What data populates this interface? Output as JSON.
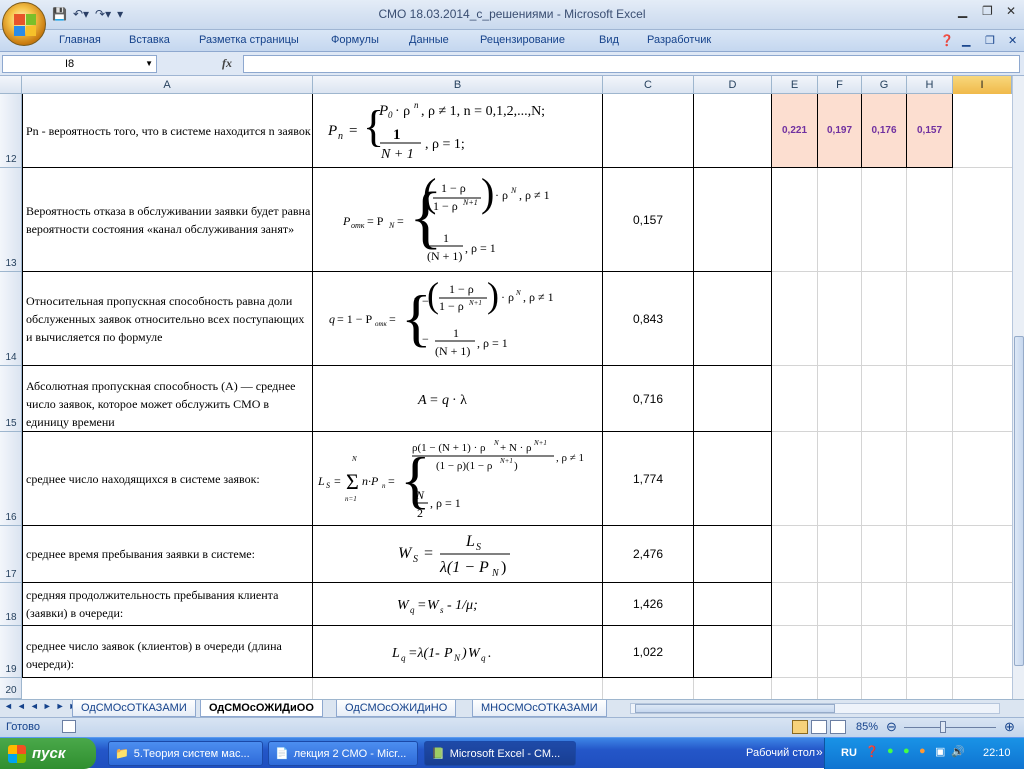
{
  "title": "СМО 18.03.2014_с_решениями - Microsoft Excel",
  "ribbon_tabs": [
    "Главная",
    "Вставка",
    "Разметка страницы",
    "Формулы",
    "Данные",
    "Рецензирование",
    "Вид",
    "Разработчик"
  ],
  "name_box": "I8",
  "fx_label": "fx",
  "columns": [
    "A",
    "B",
    "C",
    "D",
    "E",
    "F",
    "G",
    "H",
    "I"
  ],
  "rows": {
    "r12": {
      "num": "12",
      "text": "Pn  - вероятность того, что в системе находится n заявок",
      "values": [
        "0,221",
        "0,197",
        "0,176",
        "0,157"
      ]
    },
    "r13": {
      "num": "13",
      "text": "Вероятность отказа в обслуживании заявки будет равна вероятности состояния «канал обслуживания занят»",
      "c": "0,157"
    },
    "r14": {
      "num": "14",
      "text": "Относительная пропускная способность равна доли обслуженных заявок относительно всех поступающих и вычисляется по формуле",
      "c": "0,843"
    },
    "r15": {
      "num": "15",
      "text": "Абсолютная пропускная способность (А) — среднее число заявок, которое может обслужить СМО в единицу времени",
      "c": "0,716"
    },
    "r16": {
      "num": "16",
      "text": "среднее число находящихся в системе заявок:",
      "c": "1,774"
    },
    "r17": {
      "num": "17",
      "text": "среднее время пребывания заявки в системе:",
      "c": "2,476"
    },
    "r18": {
      "num": "18",
      "text": "средняя продолжительность пребывания клиента (заявки) в очереди:",
      "c": "1,426"
    },
    "r19": {
      "num": "19",
      "text": "среднее число заявок (клиентов) в очереди (длина очереди):",
      "c": "1,022"
    },
    "r20": {
      "num": "20"
    }
  },
  "sheet_tabs": [
    "ОдСМОсОТКАЗАМИ",
    "ОдСМОсОЖИДиОО",
    "ОдСМОсОЖИДиНО",
    "МНОСМОсОТКАЗАМИ"
  ],
  "active_sheet": 1,
  "status": {
    "ready": "Готово",
    "zoom": "85%"
  },
  "taskbar": {
    "start": "пуск",
    "tasks": [
      "5.Теория систем мас...",
      "лекция 2 СМО - Micr...",
      "Microsoft Excel - СМ..."
    ],
    "desktop": "Рабочий стол",
    "lang": "RU",
    "clock": "22:10"
  },
  "colors": {
    "shade": "#fcded0",
    "purple": "#7030a0",
    "ribbon_text": "#15428b"
  }
}
